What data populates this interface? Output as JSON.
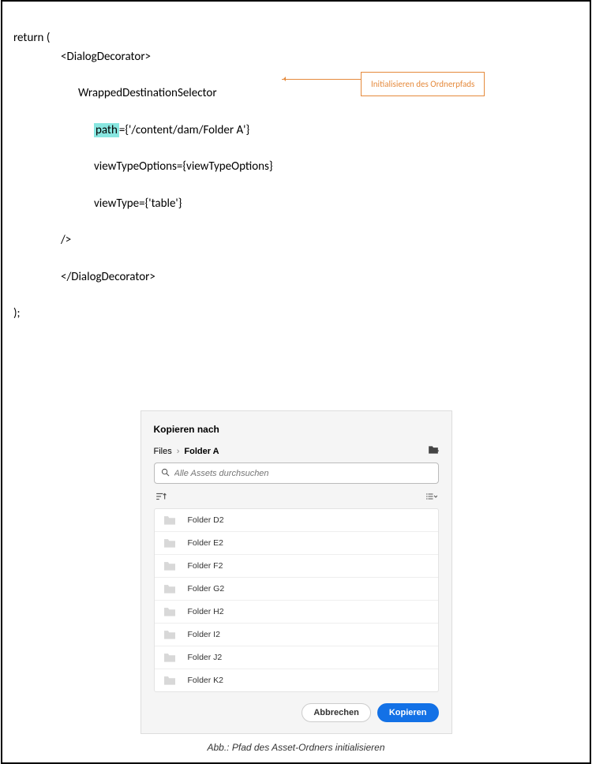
{
  "code": {
    "l1": "return (",
    "l2": "<DialogDecorator>",
    "l3": "WrappedDestinationSelector",
    "l4_hl": "path",
    "l4_rest": "={'/content/dam/Folder A'}",
    "l5": "viewTypeOptions={viewTypeOptions}",
    "l6": "viewType={'table'}",
    "l7": "/>",
    "l8": "</DialogDecorator>",
    "l9": ");"
  },
  "callout": "Initialisieren des Ordnerpfads",
  "dialog": {
    "title": "Kopieren nach",
    "crumb_root": "Files",
    "crumb_current": "Folder A",
    "search_placeholder": "Alle Assets durchsuchen",
    "folders": [
      "Folder D2",
      "Folder E2",
      "Folder F2",
      "Folder G2",
      "Folder H2",
      "Folder I2",
      "Folder J2",
      "Folder K2"
    ],
    "cancel": "Abbrechen",
    "confirm": "Kopieren"
  },
  "caption": "Abb.: Pfad des Asset-Ordners initialisieren"
}
